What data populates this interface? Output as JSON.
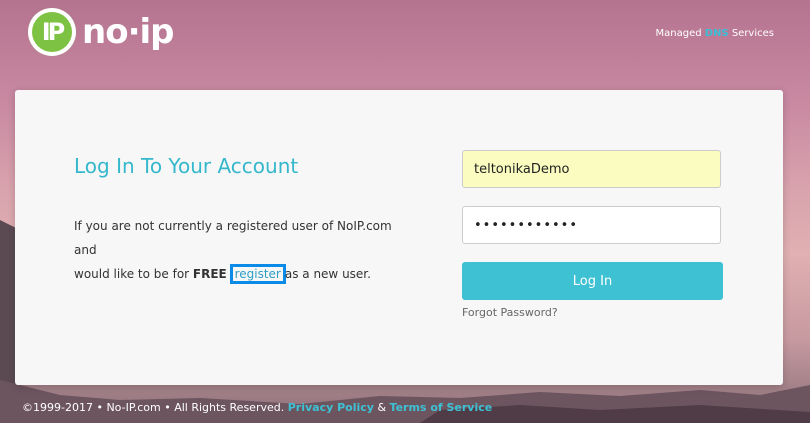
{
  "header": {
    "logo_mark": "IP",
    "logo_text": "no·ip",
    "tagline_pre": "Managed ",
    "tagline_highlight": "DNS",
    "tagline_post": " Services"
  },
  "login": {
    "title": "Log In To Your Account",
    "desc_line1": "If you are not currently a registered user of NoIP.com and",
    "desc_line2_pre": "would like to be for ",
    "desc_free": "FREE",
    "register_link": "register",
    "desc_line2_post": "as a new user.",
    "username_value": "teltonikaDemo",
    "password_value": "••••••••••••",
    "login_button": "Log In",
    "forgot_link": "Forgot Password?"
  },
  "footer": {
    "copyright": "©1999-2017 • No-IP.com • All Rights Reserved. ",
    "privacy_link": "Privacy Policy",
    "amp": " & ",
    "terms_link": "Terms of Service"
  },
  "colors": {
    "accent": "#3dc1d3",
    "logo_green": "#7dc242",
    "highlight_box": "#0a8be8"
  }
}
